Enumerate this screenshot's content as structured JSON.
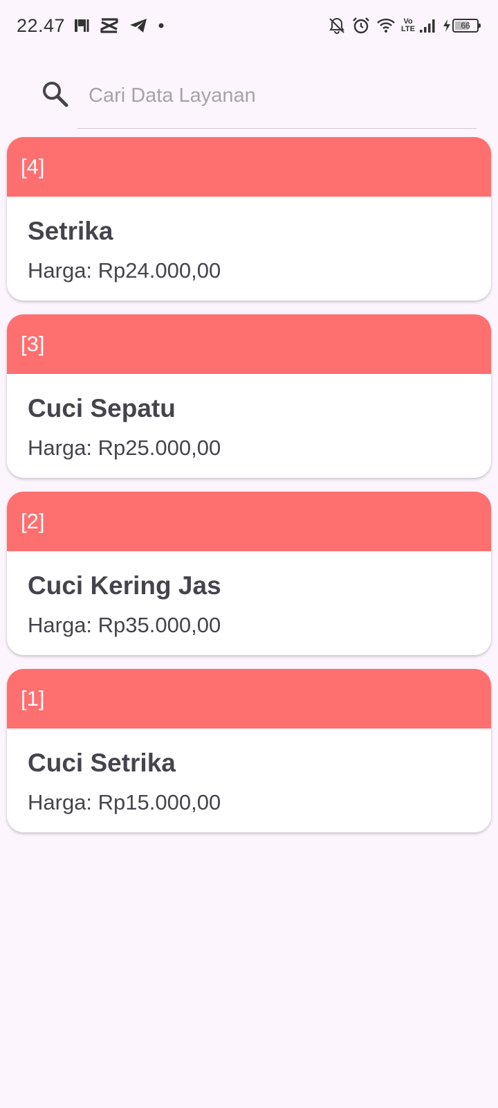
{
  "status_bar": {
    "time": "22.47",
    "network_type_top": "Vo",
    "network_type_bottom": "LTE",
    "battery_level": "66",
    "left_icons": [
      "paytren-icon",
      "capcut-icon",
      "telegram-icon",
      "dot-icon"
    ],
    "right_icons": [
      "bell-off-icon",
      "alarm-icon",
      "wifi-icon",
      "signal-icon",
      "charging-icon",
      "battery-icon"
    ]
  },
  "search": {
    "placeholder": "Cari Data Layanan",
    "value": ""
  },
  "services": [
    {
      "id_label": "[4]",
      "name": "Setrika",
      "price": "Harga: Rp24.000,00"
    },
    {
      "id_label": "[3]",
      "name": "Cuci Sepatu",
      "price": "Harga: Rp25.000,00"
    },
    {
      "id_label": "[2]",
      "name": "Cuci Kering Jas",
      "price": "Harga: Rp35.000,00"
    },
    {
      "id_label": "[1]",
      "name": "Cuci Setrika",
      "price": "Harga: Rp15.000,00"
    }
  ],
  "colors": {
    "background": "#fcf5fd",
    "card_header": "#fe6f6f",
    "text": "#45444c",
    "placeholder": "#a5a2aa"
  }
}
